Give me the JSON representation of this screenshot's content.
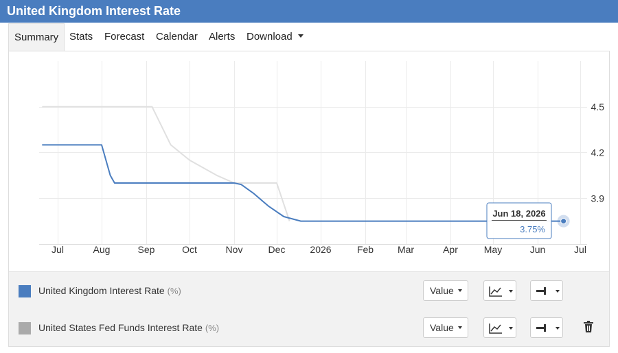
{
  "header": {
    "title": "United Kingdom Interest Rate"
  },
  "tabs": [
    {
      "label": "Summary"
    },
    {
      "label": "Stats"
    },
    {
      "label": "Forecast"
    },
    {
      "label": "Calendar"
    },
    {
      "label": "Alerts"
    },
    {
      "label": "Download"
    }
  ],
  "chart_data": {
    "type": "line",
    "x_ticks": [
      "Jul",
      "Aug",
      "Sep",
      "Oct",
      "Nov",
      "Dec",
      "2026",
      "Feb",
      "Mar",
      "Apr",
      "May",
      "Jun",
      "Jul"
    ],
    "y_ticks": [
      3.9,
      4.2,
      4.5
    ],
    "ylim": [
      3.6,
      4.8
    ],
    "grid": true,
    "colors": {
      "uk": "#4a7dbf",
      "us": "#e0e0e0",
      "grid": "#ebebeb"
    },
    "series": [
      {
        "name": "United Kingdom Interest Rate",
        "unit": "(%)",
        "color": "#4a7dbf",
        "points": [
          [
            "2025-06-20",
            4.25
          ],
          [
            "2025-08-01",
            4.25
          ],
          [
            "2025-08-07",
            4.05
          ],
          [
            "2025-08-10",
            4.0
          ],
          [
            "2025-11-01",
            4.0
          ],
          [
            "2025-11-06",
            3.99
          ],
          [
            "2025-11-15",
            3.93
          ],
          [
            "2025-11-25",
            3.85
          ],
          [
            "2025-12-06",
            3.78
          ],
          [
            "2025-12-18",
            3.75
          ],
          [
            "2026-06-18",
            3.75
          ]
        ]
      },
      {
        "name": "United States Fed Funds Interest Rate",
        "unit": "(%)",
        "color": "#e0e0e0",
        "points": [
          [
            "2025-06-20",
            4.5
          ],
          [
            "2025-09-05",
            4.5
          ],
          [
            "2025-09-18",
            4.25
          ],
          [
            "2025-10-01",
            4.15
          ],
          [
            "2025-10-20",
            4.05
          ],
          [
            "2025-11-01",
            4.0
          ],
          [
            "2025-12-01",
            4.0
          ],
          [
            "2025-12-10",
            3.75
          ]
        ]
      }
    ],
    "tooltip": {
      "date": "Jun 18, 2026",
      "value": "3.75%"
    }
  },
  "legend": {
    "uk_name": "United Kingdom Interest Rate",
    "uk_unit": "(%)",
    "us_name": "United States Fed Funds Interest Rate",
    "us_unit": "(%)",
    "value_label": "Value"
  }
}
